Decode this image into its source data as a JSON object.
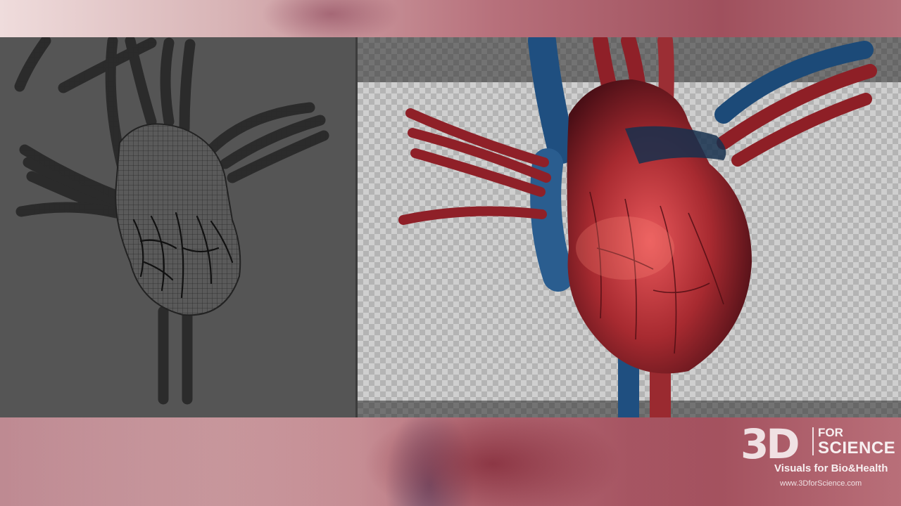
{
  "logo": {
    "mark": "3D",
    "for": "FOR",
    "science": "SCIENCE",
    "tagline": "Visuals for Bio&Health",
    "url": "www.3DforScience.com"
  },
  "views": {
    "left": {
      "icon": "wireframe-heart-icon"
    },
    "right": {
      "icon": "rendered-heart-icon"
    }
  },
  "colors": {
    "viewport_gray": "#555555",
    "artery_red": "#b5262b",
    "vein_blue": "#1f4f80"
  }
}
